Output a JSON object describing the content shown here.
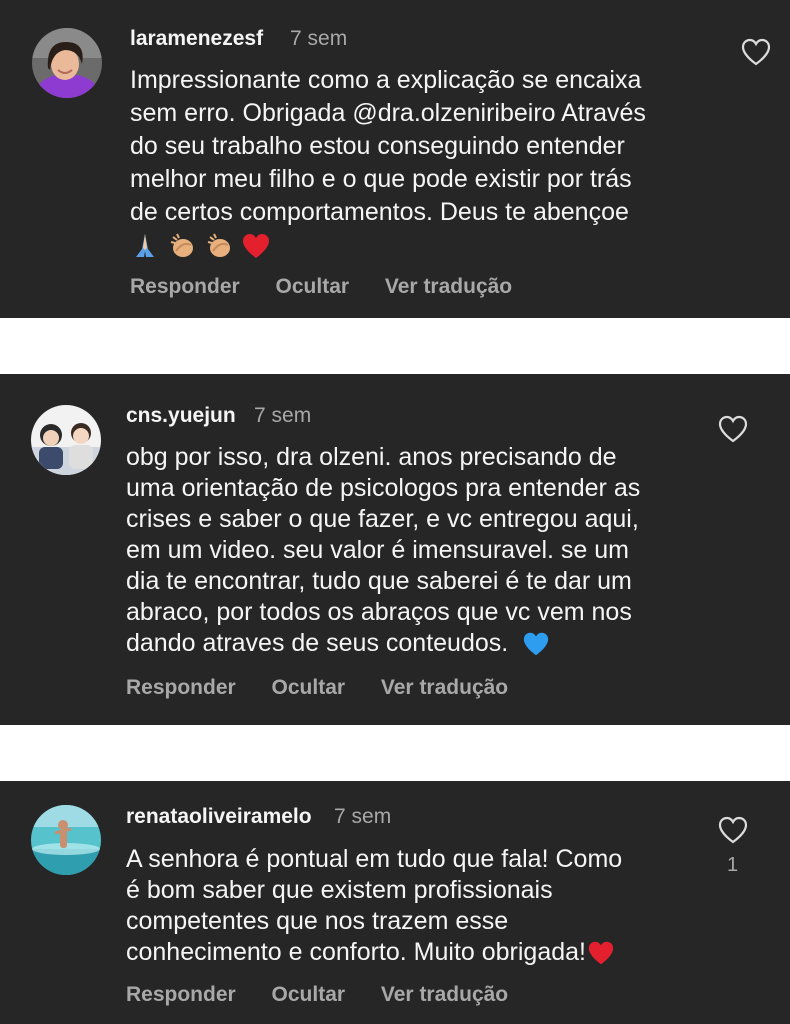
{
  "comments": [
    {
      "username": "laramenezesf",
      "time": "7 sem",
      "lines": [
        "Impressionante como a explicação se encaixa",
        "sem erro. Obrigada @dra.olzeniribeiro Através",
        "do seu trabalho estou conseguindo entender",
        "melhor meu filho e o que pode existir por trás",
        "de certos comportamentos. Deus te abençoe"
      ],
      "emojis": [
        "praying-hands-icon",
        "clapping-hands-icon",
        "clapping-hands-icon",
        "red-heart-icon"
      ],
      "reply": "Responder",
      "hide": "Ocultar",
      "translate": "Ver tradução"
    },
    {
      "username": "cns.yuejun",
      "time": "7 sem",
      "lines": [
        "obg por isso, dra olzeni. anos precisando de",
        "uma orientação de psicologos pra entender as",
        "crises e saber o que fazer, e vc entregou aqui,",
        "em um video. seu valor é imensuravel. se um",
        "dia te encontrar, tudo que saberei é te dar um",
        "abraco, por todos os abraços que vc vem nos",
        "dando atraves de seus conteudos."
      ],
      "emojis": [
        "blue-heart-icon"
      ],
      "reply": "Responder",
      "hide": "Ocultar",
      "translate": "Ver tradução"
    },
    {
      "username": "renataoliveiramelo",
      "time": "7 sem",
      "lines": [
        "A senhora é pontual em tudo que fala! Como",
        "é bom saber que existem profissionais",
        "competentes que nos trazem esse",
        "conhecimento e conforto. Muito obrigada!"
      ],
      "emojis": [
        "red-heart-icon"
      ],
      "likes": "1",
      "reply": "Responder",
      "hide": "Ocultar",
      "translate": "Ver tradução"
    }
  ],
  "colors": {
    "card_bg": "#262626",
    "separator": "#ffffff",
    "primary_text": "#f5f5f5",
    "secondary_text": "#a8a8a8"
  }
}
